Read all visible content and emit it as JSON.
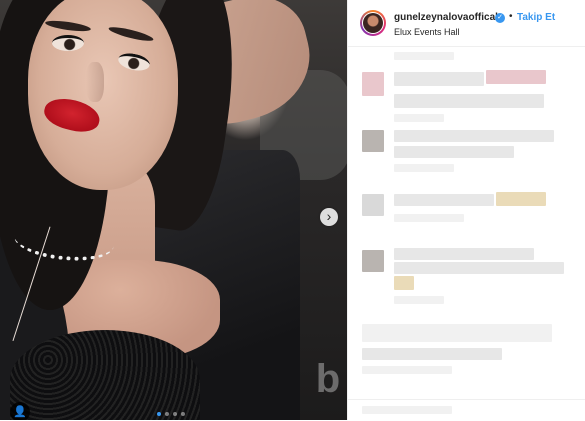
{
  "post": {
    "username": "gunelzeynalovaoffical",
    "verified_glyph": "✓",
    "separator": "•",
    "follow_label": "Takip Et",
    "location": "Elux Events Hall"
  },
  "carousel": {
    "next_glyph": "›",
    "slide_count": 4,
    "active_slide": 1
  },
  "overlay": {
    "tag_glyph": "👤",
    "watermark_glyph": "b"
  },
  "icons": {
    "verified": "verified-check-icon",
    "next": "chevron-right-icon",
    "tag": "user-tag-icon",
    "watermark": "watermark-logo"
  },
  "colors": {
    "link_blue": "#3897f0",
    "text": "#262626",
    "border": "#efefef"
  }
}
